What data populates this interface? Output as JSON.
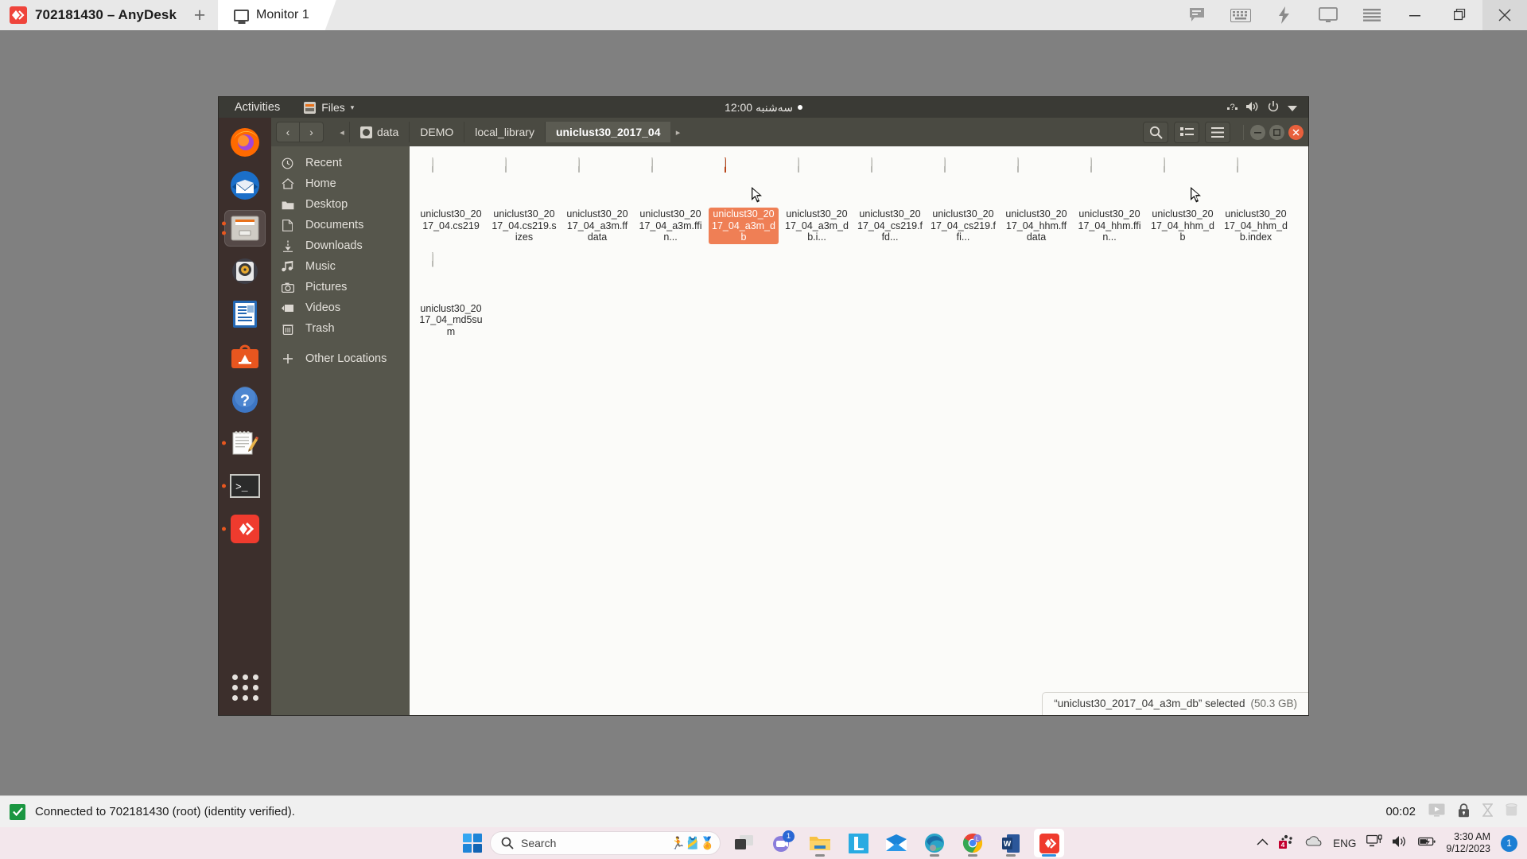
{
  "anydesk": {
    "title": "702181430 – AnyDesk",
    "new_tab_label": "+",
    "tab_label": "Monitor 1",
    "logo_icon": "anydesk-logo-icon",
    "tools": [
      {
        "name": "chat-icon",
        "label": "Chat"
      },
      {
        "name": "keyboard-icon",
        "label": "Keyboard"
      },
      {
        "name": "actions-lightning-icon",
        "label": "Actions"
      },
      {
        "name": "display-icon",
        "label": "Display"
      },
      {
        "name": "menu-icon",
        "label": "Menu"
      }
    ],
    "window_buttons": [
      {
        "name": "minimize-button",
        "glyph": "—"
      },
      {
        "name": "maximize-button",
        "glyph": "❐"
      },
      {
        "name": "close-button",
        "glyph": "✕"
      }
    ]
  },
  "gnome": {
    "activities": "Activities",
    "app_menu": "Files",
    "app_menu_caret": "▾",
    "clock": "سه‌شنبه 12:00",
    "tray": [
      {
        "name": "accessibility-icon",
        "glyph": "?"
      },
      {
        "name": "volume-icon",
        "glyph": "🔊"
      },
      {
        "name": "power-icon",
        "glyph": "⏻"
      },
      {
        "name": "system-menu-caret-icon",
        "glyph": "▾"
      }
    ]
  },
  "dock": {
    "items": [
      {
        "name": "dock-item-firefox",
        "label": "Firefox",
        "running": false
      },
      {
        "name": "dock-item-thunderbird",
        "label": "Thunderbird",
        "running": false
      },
      {
        "name": "dock-item-files",
        "label": "Files",
        "running": true,
        "active": true
      },
      {
        "name": "dock-item-rhythmbox",
        "label": "Rhythmbox",
        "running": false
      },
      {
        "name": "dock-item-libreoffice-writer",
        "label": "LibreOffice Writer",
        "running": false
      },
      {
        "name": "dock-item-ubuntu-software",
        "label": "Ubuntu Software",
        "running": false
      },
      {
        "name": "dock-item-help",
        "label": "Help",
        "running": false
      },
      {
        "name": "dock-item-text-editor",
        "label": "Text Editor",
        "running": true
      },
      {
        "name": "dock-item-terminal",
        "label": "Terminal",
        "running": true
      },
      {
        "name": "dock-item-anydesk",
        "label": "AnyDesk",
        "running": true
      }
    ],
    "show_apps_label": "Show Applications"
  },
  "nautilus": {
    "nav": {
      "back": "‹",
      "forward": "›"
    },
    "breadcrumb_left_arrow": "◂",
    "breadcrumb_right_arrow": "▸",
    "breadcrumbs": [
      {
        "label": "data",
        "current": false,
        "has_disk_icon": true
      },
      {
        "label": "DEMO",
        "current": false,
        "has_disk_icon": false
      },
      {
        "label": "local_library",
        "current": false,
        "has_disk_icon": false
      },
      {
        "label": "uniclust30_2017_04",
        "current": true,
        "has_disk_icon": false
      }
    ],
    "toolbar": [
      {
        "name": "search-icon",
        "label": "Search"
      },
      {
        "name": "view-toggle-icon",
        "label": "Toggle View"
      },
      {
        "name": "hamburger-menu-icon",
        "label": "Menu"
      }
    ],
    "window_buttons": [
      {
        "name": "minimize-button",
        "glyph": "—"
      },
      {
        "name": "maximize-button",
        "glyph": "▢"
      },
      {
        "name": "close-button",
        "glyph": "✕"
      }
    ],
    "sidebar": [
      {
        "label": "Recent",
        "icon": "clock-icon",
        "name": "sidebar-item-recent"
      },
      {
        "label": "Home",
        "icon": "home-icon",
        "name": "sidebar-item-home"
      },
      {
        "label": "Desktop",
        "icon": "folder-icon",
        "name": "sidebar-item-desktop"
      },
      {
        "label": "Documents",
        "icon": "document-icon",
        "name": "sidebar-item-documents"
      },
      {
        "label": "Downloads",
        "icon": "download-icon",
        "name": "sidebar-item-downloads"
      },
      {
        "label": "Music",
        "icon": "music-icon",
        "name": "sidebar-item-music"
      },
      {
        "label": "Pictures",
        "icon": "camera-icon",
        "name": "sidebar-item-pictures"
      },
      {
        "label": "Videos",
        "icon": "video-icon",
        "name": "sidebar-item-videos"
      },
      {
        "label": "Trash",
        "icon": "trash-icon",
        "name": "sidebar-item-trash"
      },
      {
        "label": "Other Locations",
        "icon": "plus-icon",
        "name": "sidebar-item-other-locations"
      }
    ],
    "files": [
      {
        "label": "uniclust30_2017_04.cs219",
        "type": "binary",
        "selected": false,
        "cursor": false
      },
      {
        "label": "uniclust30_2017_04.cs219.sizes",
        "type": "text",
        "selected": false,
        "cursor": false
      },
      {
        "label": "uniclust30_2017_04_a3m.ffdata",
        "type": "binary",
        "selected": false,
        "cursor": false
      },
      {
        "label": "uniclust30_2017_04_a3m.ffin...",
        "type": "text",
        "selected": false,
        "cursor": false
      },
      {
        "label": "uniclust30_2017_04_a3m_db",
        "type": "binary",
        "selected": true,
        "cursor": true
      },
      {
        "label": "uniclust30_2017_04_a3m_db.i...",
        "type": "text",
        "selected": false,
        "cursor": false
      },
      {
        "label": "uniclust30_2017_04_cs219.ffd...",
        "type": "binary",
        "selected": false,
        "cursor": false
      },
      {
        "label": "uniclust30_2017_04_cs219.ffi...",
        "type": "text",
        "selected": false,
        "cursor": false
      },
      {
        "label": "uniclust30_2017_04_hhm.ffdata",
        "type": "binary",
        "selected": false,
        "cursor": false
      },
      {
        "label": "uniclust30_2017_04_hhm.ffin...",
        "type": "text",
        "selected": false,
        "cursor": false
      },
      {
        "label": "uniclust30_2017_04_hhm_db",
        "type": "binary",
        "selected": false,
        "cursor": true
      },
      {
        "label": "uniclust30_2017_04_hhm_db.index",
        "type": "text",
        "selected": false,
        "cursor": false
      },
      {
        "label": "uniclust30_2017_04_md5sum",
        "type": "text",
        "selected": false,
        "cursor": false
      }
    ],
    "status": {
      "text": "“uniclust30_2017_04_a3m_db” selected",
      "size": "(50.3 GB)"
    }
  },
  "windows_status": {
    "check_icon": "checkmark-icon",
    "message": "Connected to 702181430 (root) (identity verified).",
    "timer": "00:02",
    "tray": [
      {
        "name": "screen-share-icon",
        "glyph": "▶"
      },
      {
        "name": "lock-icon",
        "glyph": "🔒"
      },
      {
        "name": "hourglass-icon",
        "glyph": "⧗"
      },
      {
        "name": "storage-icon",
        "glyph": "▤"
      }
    ]
  },
  "taskbar": {
    "start_label": "Start",
    "search": {
      "placeholder": "Search",
      "name": "search-input"
    },
    "apps": [
      {
        "name": "taskbar-app-task-view",
        "label": "Task View",
        "running": false,
        "badge": ""
      },
      {
        "name": "taskbar-app-teams",
        "label": "Microsoft Teams",
        "running": false,
        "badge": "1"
      },
      {
        "name": "taskbar-app-file-explorer",
        "label": "File Explorer",
        "running": true,
        "badge": ""
      },
      {
        "name": "taskbar-app-l",
        "label": "LinkedIn",
        "running": false,
        "badge": ""
      },
      {
        "name": "taskbar-app-mail",
        "label": "Mail",
        "running": false,
        "badge": ""
      },
      {
        "name": "taskbar-app-edge",
        "label": "Microsoft Edge",
        "running": true,
        "badge": ""
      },
      {
        "name": "taskbar-app-chrome",
        "label": "Google Chrome",
        "running": true,
        "badge": ""
      },
      {
        "name": "taskbar-app-word",
        "label": "Microsoft Word",
        "running": true,
        "badge": ""
      },
      {
        "name": "taskbar-app-anydesk",
        "label": "AnyDesk",
        "running": true,
        "active": true,
        "badge": ""
      }
    ],
    "tray": {
      "chevron": "^",
      "language": "ENG",
      "icons": [
        {
          "name": "tray-overflow-icon",
          "glyph": "^"
        },
        {
          "name": "antivirus-icon",
          "glyph": "4"
        },
        {
          "name": "onedrive-cloud-icon",
          "glyph": "☁"
        },
        {
          "name": "network-icon",
          "glyph": "🖥"
        },
        {
          "name": "volume-icon",
          "glyph": "🔊"
        },
        {
          "name": "battery-icon",
          "glyph": "🔋"
        }
      ],
      "time": "3:30 AM",
      "date": "9/12/2023",
      "notification_count": "1"
    }
  }
}
